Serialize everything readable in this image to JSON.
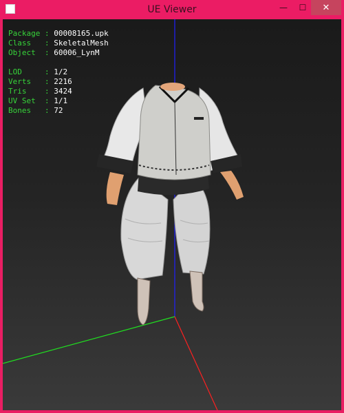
{
  "window": {
    "title": "UE Viewer"
  },
  "controls": {
    "minimize": "—",
    "maximize": "☐",
    "close": "✕"
  },
  "info": {
    "group1": [
      {
        "label": "Package",
        "value": "00008165.upk"
      },
      {
        "label": "Class",
        "value": "SkeletalMesh"
      },
      {
        "label": "Object",
        "value": "60006_LynM"
      }
    ],
    "group2": [
      {
        "label": "LOD",
        "value": "1/2"
      },
      {
        "label": "Verts",
        "value": "2216"
      },
      {
        "label": "Tris",
        "value": "3424"
      },
      {
        "label": "UV Set",
        "value": "1/1"
      },
      {
        "label": "Bones",
        "value": "72"
      }
    ]
  },
  "axes": {
    "x_color": "#ff2020",
    "y_color": "#20e020",
    "z_color": "#2020ff"
  },
  "colors": {
    "title_bar": "#eb1c64",
    "info_label": "#37d43a",
    "info_value": "#ffffff"
  }
}
